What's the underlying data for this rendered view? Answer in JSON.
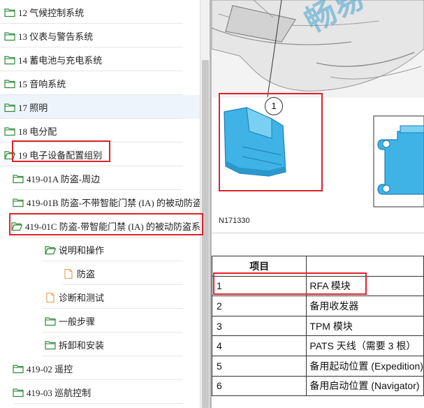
{
  "tree": {
    "items": [
      {
        "label": "12 气候控制系统",
        "icon": "folder-icon"
      },
      {
        "label": "13 仪表与警告系统",
        "icon": "folder-icon"
      },
      {
        "label": "14 蓄电池与充电系统",
        "icon": "folder-icon"
      },
      {
        "label": "15 音响系统",
        "icon": "folder-icon"
      },
      {
        "label": "17 照明",
        "icon": "folder-icon"
      },
      {
        "label": "18 电分配",
        "icon": "folder-icon"
      },
      {
        "label": "19 电子设备配置组别",
        "icon": "folder-open-icon"
      },
      {
        "label": "419-01A 防盗-周边",
        "icon": "folder-icon"
      },
      {
        "label": "419-01B 防盗-不带智能门禁 (IA) 的被动防盗",
        "icon": "folder-icon"
      },
      {
        "label": "419-01C 防盗-带智能门禁 (IA) 的被动防盗系",
        "icon": "folder-open-icon"
      },
      {
        "label": "说明和操作",
        "icon": "folder-open-icon"
      },
      {
        "label": "防盗",
        "icon": "document-icon"
      },
      {
        "label": "诊断和测试",
        "icon": "document-icon"
      },
      {
        "label": "一般步骤",
        "icon": "folder-icon"
      },
      {
        "label": "拆卸和安装",
        "icon": "folder-icon"
      },
      {
        "label": "419-02 遥控",
        "icon": "folder-icon"
      },
      {
        "label": "419-03 巡航控制",
        "icon": "folder-icon"
      }
    ]
  },
  "doc": {
    "watermark": "畅易",
    "callout_number": "1",
    "figure_label": "N171330",
    "table": {
      "header_item": "项目",
      "rows": [
        {
          "num": "1",
          "item": "RFA 模块"
        },
        {
          "num": "2",
          "item": "备用收发器"
        },
        {
          "num": "3",
          "item": "TPM 模块"
        },
        {
          "num": "4",
          "item": "PATS 天线（需要 3 根）"
        },
        {
          "num": "5",
          "item": "备用起动位置 (Expedition)"
        },
        {
          "num": "6",
          "item": "备用启动位置 (Navigator)"
        }
      ]
    }
  },
  "colors": {
    "highlight": "#e0212b",
    "folder": "#2e8b3a",
    "document": "#e8a25a",
    "module": "#3fb3e6"
  }
}
